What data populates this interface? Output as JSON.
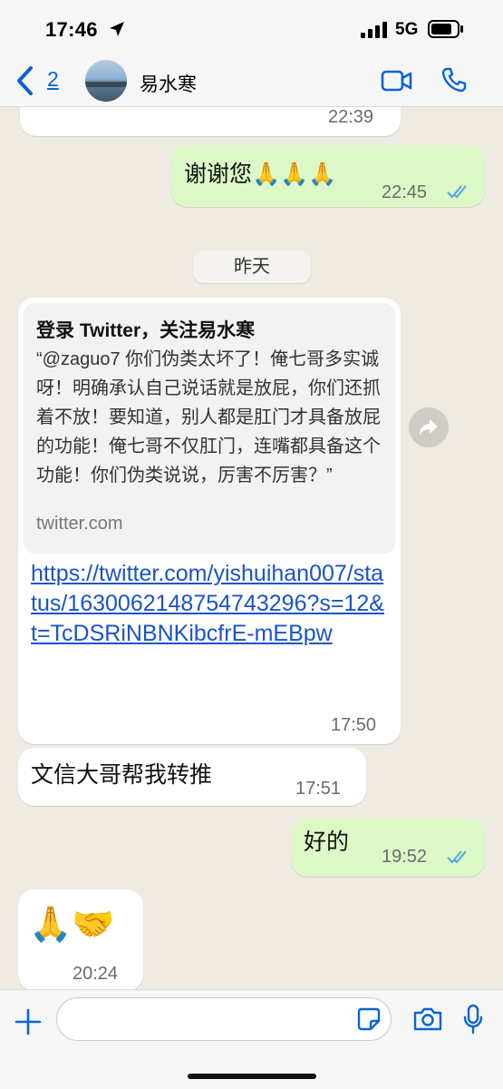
{
  "status_bar": {
    "time": "17:46",
    "network": "5G",
    "icons": [
      "location-arrow-icon",
      "signal-bars-icon",
      "battery-icon"
    ]
  },
  "header": {
    "back_count": "2",
    "contact_name": "易水寒",
    "icons": [
      "back-chevron-icon",
      "video-call-icon",
      "phone-call-icon"
    ]
  },
  "messages": [
    {
      "direction": "incoming",
      "time": "22:39"
    },
    {
      "direction": "outgoing",
      "text": "谢谢您🙏🙏🙏",
      "time": "22:45",
      "status": "read"
    },
    {
      "date_separator": "昨天"
    },
    {
      "direction": "incoming",
      "link_preview": {
        "title": "登录 Twitter，关注易水寒",
        "description": "“@zaguo7 你们伪类太坏了！俺七哥多实诚呀！明确承认自己说话就是放屁，你们还抓着不放！要知道，别人都是肛门才具备放屁的功能！俺七哥不仅肛门，连嘴都具备这个功能！你们伪类说说，厉害不厉害？”",
        "domain": "twitter.com"
      },
      "link": "https://twitter.com/yishuihan007/status/1630062148754743296?s=12&t=TcDSRiNBNKibcfrE-mEBpw",
      "time": "17:50"
    },
    {
      "direction": "incoming",
      "text": "文信大哥帮我转推",
      "time": "17:51"
    },
    {
      "direction": "outgoing",
      "text": "好的",
      "time": "19:52",
      "status": "read"
    },
    {
      "direction": "incoming",
      "text": "🙏🤝",
      "time": "20:24"
    }
  ],
  "input": {
    "placeholder": "",
    "value": ""
  },
  "colors": {
    "incoming_bubble": "#ffffff",
    "outgoing_bubble": "#dcf8c6",
    "accent": "#0a64d6",
    "link": "#1a54c7",
    "read_ticks": "#4fa3e8",
    "background": "#efeae2"
  }
}
